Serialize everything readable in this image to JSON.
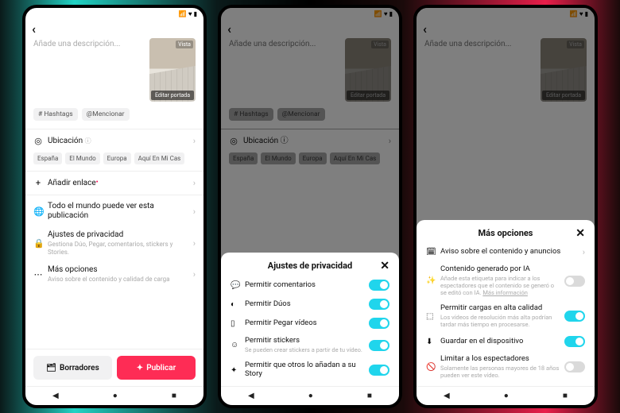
{
  "status_icons": "📶 ♥ ▮",
  "screen1": {
    "desc_placeholder": "Añade una descripción...",
    "thumb_badge": "Vista",
    "thumb_edit": "Editar portada",
    "chip_hashtags": "# Hashtags",
    "chip_mention": "@Mencionar",
    "loc_label": "Ubicación",
    "loc_chip1": "España",
    "loc_chip2": "El Mundo",
    "loc_chip3": "Europa",
    "loc_chip4": "Aquí En Mi Cas",
    "add_link": "Añadir enlace",
    "visibility": "Todo el mundo puede ver esta publicación",
    "privacy_label": "Ajustes de privacidad",
    "privacy_sub": "Gestiona Dúo, Pegar, comentarios, stickers y Stories.",
    "more_label": "Más opciones",
    "more_sub": "Aviso sobre el contenido y calidad de carga",
    "drafts": "Borradores",
    "publish": "Publicar"
  },
  "sheet2": {
    "title": "Ajustes de privacidad",
    "r1": "Permitir comentarios",
    "r2": "Permitir Dúos",
    "r3": "Permitir Pegar vídeos",
    "r4": "Permitir stickers",
    "r4_sub": "Se pueden crear stickers a partir de tu vídeo.",
    "r5": "Permitir que otros lo añadan a su Story"
  },
  "sheet3": {
    "title": "Más opciones",
    "r1": "Aviso sobre el contenido y anuncios",
    "r2": "Contenido generado por IA",
    "r2_sub": "Añade esta etiqueta para indicar a los espectadores que el contenido se generó o se editó con IA. ",
    "r2_link": "Más información",
    "r3": "Permitir cargas en alta calidad",
    "r3_sub": "Los vídeos de resolución más alta podrían tardar más tiempo en procesarse.",
    "r4": "Guardar en el dispositivo",
    "r5": "Limitar a los espectadores",
    "r5_sub": "Solamente las personas mayores de 18 años pueden ver este vídeo."
  }
}
